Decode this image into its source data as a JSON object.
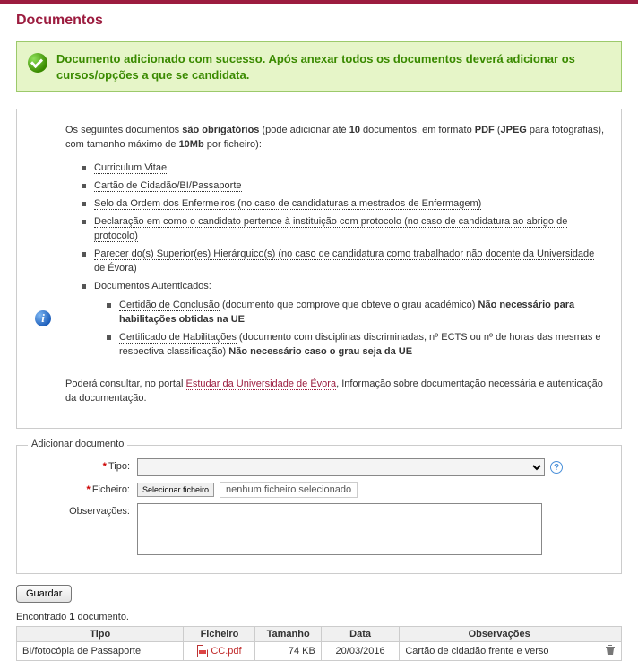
{
  "page": {
    "title": "Documentos"
  },
  "success": {
    "message": "Documento adicionado com sucesso. Após anexar todos os documentos deverá adicionar os cursos/opções a que se candidata."
  },
  "info": {
    "intro_pre": "Os seguintes documentos ",
    "intro_bold1": "são obrigatórios",
    "intro_mid1": " (pode adicionar até ",
    "intro_bold2": "10",
    "intro_mid2": " documentos, em formato ",
    "intro_bold3": "PDF",
    "intro_paren": " (",
    "intro_bold4": "JPEG",
    "intro_mid3": " para fotografias), com tamanho máximo de ",
    "intro_bold5": "10Mb",
    "intro_post": " por ficheiro):",
    "items": {
      "cv": "Curriculum Vitae",
      "cc": "Cartão de Cidadão/BI/Passaporte",
      "selo": "Selo da Ordem dos Enfermeiros (no caso de candidaturas a mestrados de Enfermagem)",
      "decl": "Declaração em como o candidato pertence à instituição com protocolo (no caso de candidatura ao abrigo de protocolo)",
      "parecer": "Parecer do(s) Superior(es) Hierárquico(s) (no caso de candidatura como trabalhador não docente da Universidade de Évora)",
      "docs_aut": "Documentos Autenticados:",
      "cert_conc_link": "Certidão de Conclusão",
      "cert_conc_rest": " (documento que comprove que obteve o grau académico) ",
      "cert_conc_bold": "Não necessário para habilitações obtidas na UE",
      "cert_hab_link": "Certificado de Habilitações",
      "cert_hab_rest": " (documento com disciplinas discriminadas, nº ECTS ou nº de horas das mesmas e respectiva classificação) ",
      "cert_hab_bold": "Não necessário caso o grau seja da UE"
    },
    "footer_pre": "Poderá consultar, no portal ",
    "footer_link": "Estudar da Universidade de Évora",
    "footer_post": ", Informação sobre documentação necessária e autenticação da documentação."
  },
  "form": {
    "legend": "Adicionar documento",
    "labels": {
      "tipo": "Tipo:",
      "ficheiro": "Ficheiro:",
      "obs": "Observações:"
    },
    "file_button": "Selecionar ficheiro",
    "file_status": "nenhum ficheiro selecionado",
    "save": "Guardar"
  },
  "results": {
    "found_pre": "Encontrado ",
    "found_n": "1",
    "found_post": " documento.",
    "headers": {
      "tipo": "Tipo",
      "ficheiro": "Ficheiro",
      "tamanho": "Tamanho",
      "data": "Data",
      "obs": "Observações"
    },
    "row": {
      "tipo": "BI/fotocópia de Passaporte",
      "ficheiro": "CC.pdf",
      "tamanho": "74 KB",
      "data": "20/03/2016",
      "obs": "Cartão de cidadão frente e verso"
    }
  }
}
